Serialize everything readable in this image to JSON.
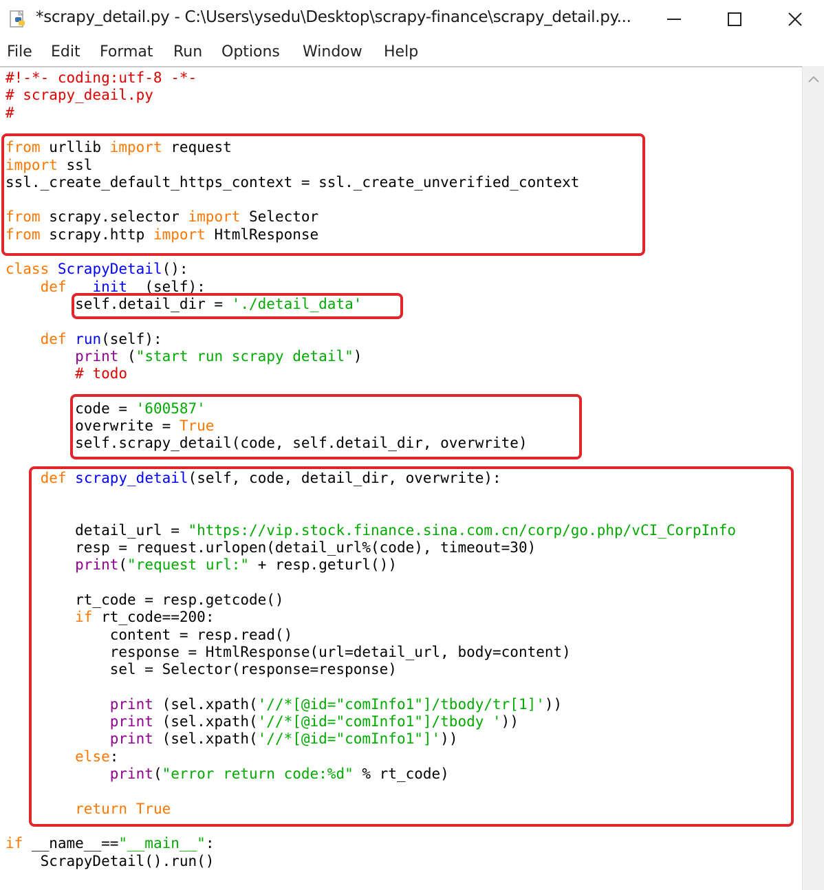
{
  "window": {
    "title": "*scrapy_detail.py - C:\\Users\\ysedu\\Desktop\\scrapy-finance\\scrapy_detail.py...",
    "icons": [
      "python-file-icon",
      "minimize-icon",
      "maximize-icon",
      "close-icon"
    ]
  },
  "menu": [
    "File",
    "Edit",
    "Format",
    "Run",
    "Options",
    "Window",
    "Help"
  ],
  "colors": {
    "keyword": "#ff7700",
    "comment": "#dd0000",
    "string": "#00aa00",
    "definition": "#0000ff",
    "builtin": "#900090",
    "highlight_box": "#e1262b"
  },
  "code_lines": [
    [
      [
        "c",
        "#!-*- coding:utf-8 -*-"
      ]
    ],
    [
      [
        "c",
        "# scrapy_deail.py"
      ]
    ],
    [
      [
        "c",
        "#"
      ]
    ],
    [],
    [
      [
        "k",
        "from"
      ],
      [
        "n",
        " urllib "
      ],
      [
        "k",
        "import"
      ],
      [
        "n",
        " request"
      ]
    ],
    [
      [
        "k",
        "import"
      ],
      [
        "n",
        " ssl"
      ]
    ],
    [
      [
        "n",
        "ssl._create_default_https_context = ssl._create_unverified_context"
      ]
    ],
    [],
    [
      [
        "k",
        "from"
      ],
      [
        "n",
        " scrapy.selector "
      ],
      [
        "k",
        "import"
      ],
      [
        "n",
        " Selector"
      ]
    ],
    [
      [
        "k",
        "from"
      ],
      [
        "n",
        " scrapy.http "
      ],
      [
        "k",
        "import"
      ],
      [
        "n",
        " HtmlResponse"
      ]
    ],
    [],
    [
      [
        "k",
        "class"
      ],
      [
        "n",
        " "
      ],
      [
        "d",
        "ScrapyDetail"
      ],
      [
        "n",
        "():"
      ]
    ],
    [
      [
        "n",
        "    "
      ],
      [
        "k",
        "def"
      ],
      [
        "n",
        " "
      ],
      [
        "d",
        "__init__"
      ],
      [
        "n",
        "(self):"
      ]
    ],
    [
      [
        "n",
        "        self.detail_dir = "
      ],
      [
        "s",
        "'./detail_data'"
      ]
    ],
    [],
    [
      [
        "n",
        "    "
      ],
      [
        "k",
        "def"
      ],
      [
        "n",
        " "
      ],
      [
        "d",
        "run"
      ],
      [
        "n",
        "(self):"
      ]
    ],
    [
      [
        "n",
        "        "
      ],
      [
        "b",
        "print"
      ],
      [
        "n",
        " ("
      ],
      [
        "s",
        "\"start run scrapy detail\""
      ],
      [
        "n",
        ")"
      ]
    ],
    [
      [
        "n",
        "        "
      ],
      [
        "c",
        "# todo"
      ]
    ],
    [],
    [
      [
        "n",
        "        code = "
      ],
      [
        "s",
        "'600587'"
      ]
    ],
    [
      [
        "n",
        "        overwrite = "
      ],
      [
        "k",
        "True"
      ]
    ],
    [
      [
        "n",
        "        self.scrapy_detail(code, self.detail_dir, overwrite)"
      ]
    ],
    [],
    [
      [
        "n",
        "    "
      ],
      [
        "k",
        "def"
      ],
      [
        "n",
        " "
      ],
      [
        "d",
        "scrapy_detail"
      ],
      [
        "n",
        "(self, code, detail_dir, overwrite):"
      ]
    ],
    [],
    [],
    [
      [
        "n",
        "        detail_url = "
      ],
      [
        "s",
        "\"https://vip.stock.finance.sina.com.cn/corp/go.php/vCI_CorpInfo"
      ]
    ],
    [
      [
        "n",
        "        resp = request.urlopen(detail_url%(code), timeout=30)"
      ]
    ],
    [
      [
        "n",
        "        "
      ],
      [
        "b",
        "print"
      ],
      [
        "n",
        "("
      ],
      [
        "s",
        "\"request url:\""
      ],
      [
        "n",
        " + resp.geturl())"
      ]
    ],
    [],
    [
      [
        "n",
        "        rt_code = resp.getcode()"
      ]
    ],
    [
      [
        "n",
        "        "
      ],
      [
        "k",
        "if"
      ],
      [
        "n",
        " rt_code==200:"
      ]
    ],
    [
      [
        "n",
        "            content = resp.read()"
      ]
    ],
    [
      [
        "n",
        "            response = HtmlResponse(url=detail_url, body=content)"
      ]
    ],
    [
      [
        "n",
        "            sel = Selector(response=response)"
      ]
    ],
    [],
    [
      [
        "n",
        "            "
      ],
      [
        "b",
        "print"
      ],
      [
        "n",
        " (sel.xpath("
      ],
      [
        "s",
        "'//*[@id=\"comInfo1\"]/tbody/tr[1]'"
      ],
      [
        "n",
        "))"
      ]
    ],
    [
      [
        "n",
        "            "
      ],
      [
        "b",
        "print"
      ],
      [
        "n",
        " (sel.xpath("
      ],
      [
        "s",
        "'//*[@id=\"comInfo1\"]/tbody '"
      ],
      [
        "n",
        "))"
      ]
    ],
    [
      [
        "n",
        "            "
      ],
      [
        "b",
        "print"
      ],
      [
        "n",
        " (sel.xpath("
      ],
      [
        "s",
        "'//*[@id=\"comInfo1\"]'"
      ],
      [
        "n",
        "))"
      ]
    ],
    [
      [
        "n",
        "        "
      ],
      [
        "k",
        "else"
      ],
      [
        "n",
        ":"
      ]
    ],
    [
      [
        "n",
        "            "
      ],
      [
        "b",
        "print"
      ],
      [
        "n",
        "("
      ],
      [
        "s",
        "\"error return code:%d\""
      ],
      [
        "n",
        " % rt_code)"
      ]
    ],
    [],
    [
      [
        "n",
        "        "
      ],
      [
        "k",
        "return"
      ],
      [
        "n",
        " "
      ],
      [
        "k",
        "True"
      ]
    ],
    [],
    [
      [
        "k",
        "if"
      ],
      [
        "n",
        " __name__=="
      ],
      [
        "s",
        "\"__main__\""
      ],
      [
        "n",
        ":"
      ]
    ],
    [
      [
        "n",
        "    ScrapyDetail().run()"
      ]
    ]
  ]
}
